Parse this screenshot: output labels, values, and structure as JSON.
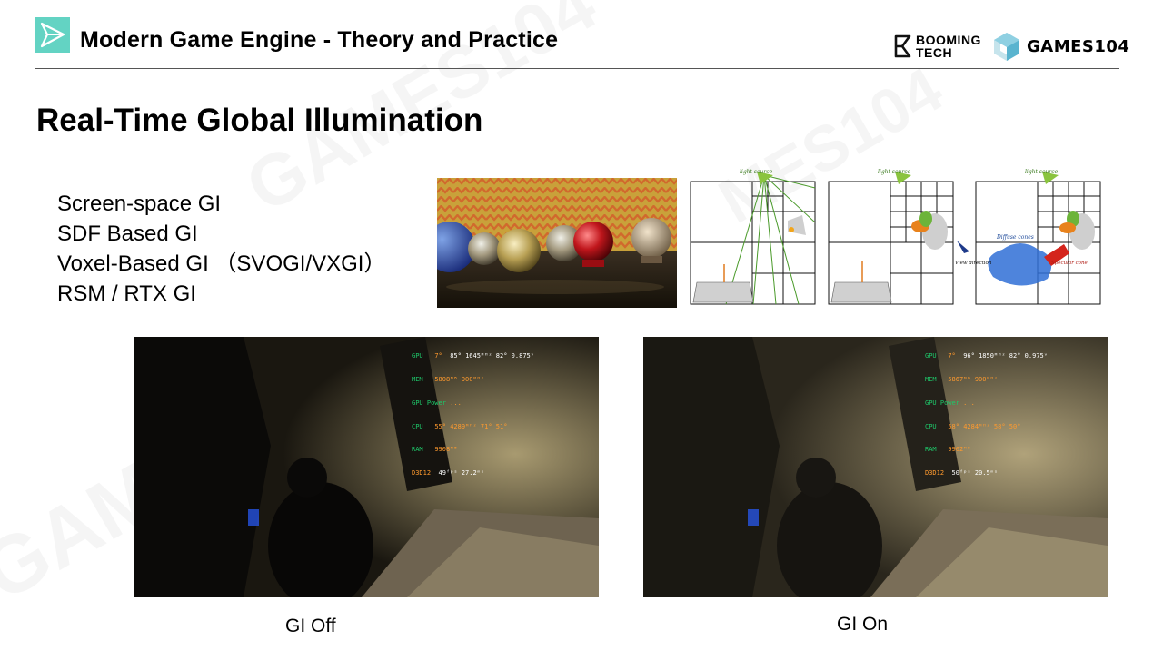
{
  "header": {
    "title": "Modern Game Engine - Theory and Practice",
    "logos": [
      {
        "icon": "booming-tech-logo-icon",
        "line1": "BOOMING",
        "line2": "TECH"
      },
      {
        "icon": "games104-cube-icon",
        "text": "GAMES104"
      }
    ]
  },
  "slide": {
    "title": "Real-Time Global Illumination",
    "bullets": [
      "Screen-space GI",
      "SDF Based GI",
      "Voxel-Based GI （SVOGI/VXGI）",
      "RSM / RTX GI"
    ]
  },
  "diagram_labels": {
    "light_source": "light source",
    "diffuse_cones": "Diffuse cones",
    "view_direction": "View direction",
    "specular_cone": "Specular cone"
  },
  "screenshots": {
    "gi_off": {
      "caption": "GI Off",
      "hud": {
        "gpu": [
          "GPU",
          "7°",
          "85°",
          "1645ᴹᴴᶻ",
          "82°",
          "0.875ᵛ"
        ],
        "mem": [
          "MEM",
          "5808ᴹᴮ",
          "900ᴹᴴᶻ"
        ],
        "gpu_power": [
          "GPU Power",
          "..."
        ],
        "cpu": [
          "CPU",
          "55°",
          "4289ᴹᴴᶻ",
          "71°",
          "51°"
        ],
        "ram": [
          "RAM",
          "9908ᴹᴮ"
        ],
        "d3d": [
          "D3D12",
          "49ᶠᵖˢ",
          "27.2ᵐˢ"
        ]
      }
    },
    "gi_on": {
      "caption": "GI On",
      "hud": {
        "gpu": [
          "GPU",
          "7°",
          "96°",
          "1850ᴹᴴᶻ",
          "82°",
          "0.975ᵛ"
        ],
        "mem": [
          "MEM",
          "5867ᴹᴮ",
          "900ᴹᴴᶻ"
        ],
        "gpu_power": [
          "GPU Power",
          "..."
        ],
        "cpu": [
          "CPU",
          "58°",
          "4284ᴹᴴᶻ",
          "58°",
          "50°"
        ],
        "ram": [
          "RAM",
          "9902ᴹᴮ"
        ],
        "d3d": [
          "D3D12",
          "50ᶠᵖˢ",
          "20.5ᵐˢ"
        ]
      }
    }
  },
  "colors": {
    "accent": "#63d3c3",
    "hud_label": "#1ec86a",
    "hud_value": "#ff9a2e"
  }
}
